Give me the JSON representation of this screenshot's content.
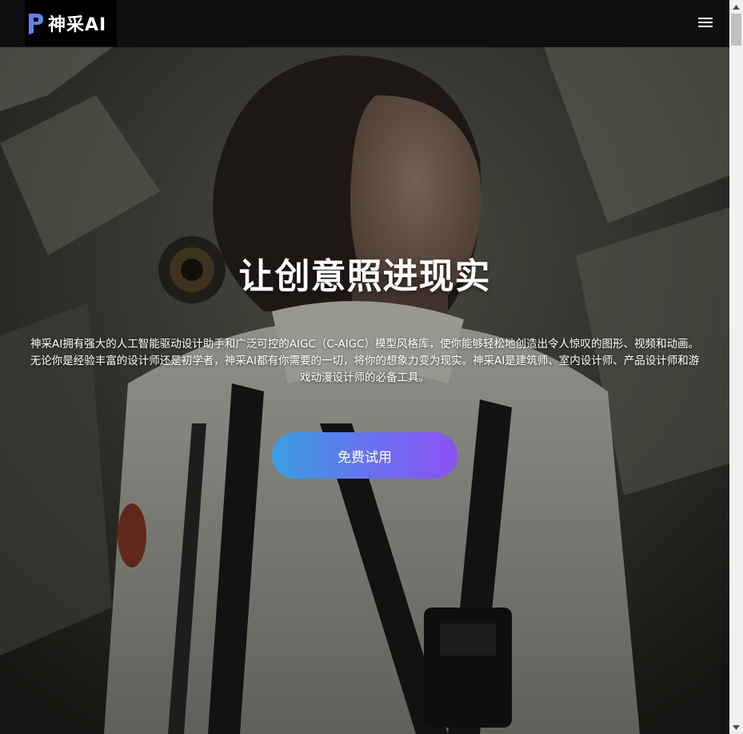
{
  "header": {
    "logo_text": "神采AI",
    "menu_icon": "hamburger-menu-icon"
  },
  "hero": {
    "title": "让创意照进现实",
    "description_line1": "神采AI拥有强大的人工智能驱动设计助手和广泛可控的AIGC（C-AIGC）模型风格库，使你能够轻松地创造出令人惊叹的图形、视频和动画。",
    "description_line2": "无论你是经验丰富的设计师还是初学者，神采AI都有你需要的一切，将你的想象力变为现实。神采AI是建筑师、室内设计师、产品设计师和游",
    "description_line3": "戏动漫设计师的必备工具。",
    "cta_label": "免费试用"
  },
  "colors": {
    "header_bg": "#0f0f10",
    "cta_gradient_start": "#3a9fe0",
    "cta_gradient_end": "#8c52f5",
    "logo_accent": "#5b7cf7"
  }
}
